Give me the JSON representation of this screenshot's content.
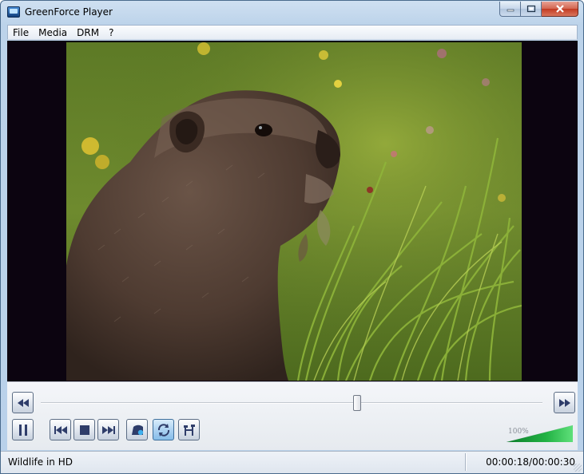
{
  "window": {
    "title": "GreenForce Player",
    "icon": "app-icon",
    "caption_buttons": [
      "minimize-icon",
      "maximize-icon",
      "close-icon"
    ]
  },
  "menu": {
    "items": [
      "File",
      "Media",
      "DRM",
      "?"
    ]
  },
  "video": {
    "content": "marmot-video-frame",
    "letterbox_color": "#0c0410"
  },
  "controls": {
    "seek_position_fraction": 0.63,
    "buttons": {
      "rewind": "rewind-icon",
      "fast_forward": "fast-forward-icon",
      "pause": "pause-icon",
      "previous": "skip-previous-icon",
      "stop": "stop-icon",
      "next": "skip-next-icon",
      "eject": "eject-icon",
      "repeat": "repeat-icon",
      "tools": "tools-icon"
    },
    "volume": {
      "label": "100%",
      "level_fraction": 1.0,
      "color": "#2bc04a"
    }
  },
  "status": {
    "title": "Wildlife in HD",
    "time": "00:00:18/00:00:30"
  }
}
